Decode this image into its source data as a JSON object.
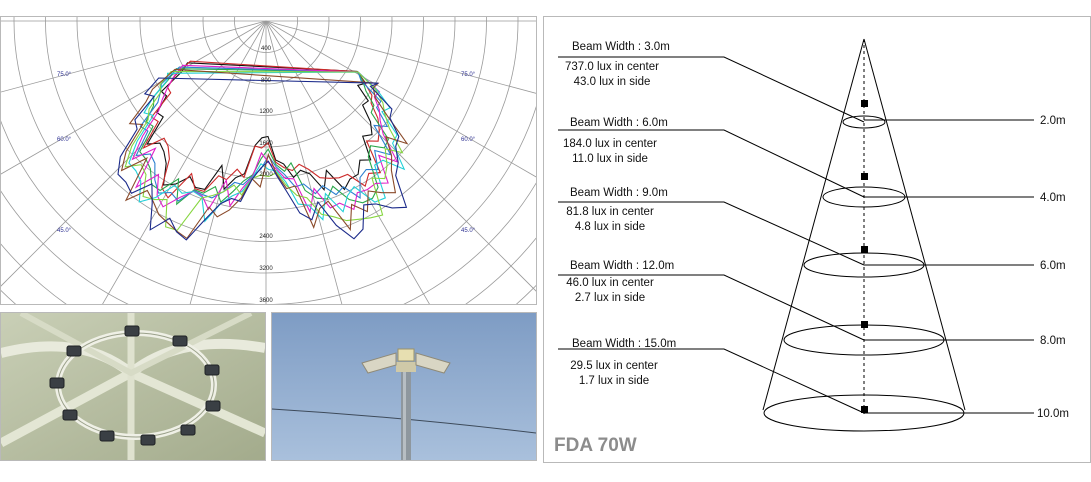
{
  "polar": {
    "angle_labels": [
      "75.0°",
      "75.0°",
      "60.0°",
      "60.0°",
      "45.0°",
      "45.0°"
    ],
    "radial_labels": [
      "400",
      "800",
      "1200",
      "1600",
      "2000",
      "2400",
      "2800",
      "3200",
      "3600"
    ],
    "curve_colors": [
      "#111111",
      "#cc2a2a",
      "#2aa84a",
      "#2c7fd0",
      "#e020c8",
      "#22d0d8",
      "#86d640",
      "#8a4a2a",
      "#1b2a8a"
    ]
  },
  "photos": {
    "fixture_alt": "ring fixture",
    "pole_alt": "pole lights"
  },
  "cone": {
    "title": "FDA 70W",
    "levels": [
      {
        "beam": "Beam Width : 3.0m",
        "center": "737.0 lux in center",
        "side": "43.0 lux in side",
        "height": "2.0m"
      },
      {
        "beam": "Beam Width : 6.0m",
        "center": "184.0 lux in center",
        "side": "11.0 lux in side",
        "height": "4.0m"
      },
      {
        "beam": "Beam Width : 9.0m",
        "center": "81.8 lux in center",
        "side": "4.8 lux in side",
        "height": "6.0m"
      },
      {
        "beam": "Beam Width : 12.0m",
        "center": "46.0 lux in center",
        "side": "2.7 lux in side",
        "height": "8.0m"
      },
      {
        "beam": "Beam Width : 15.0m",
        "center": "29.5 lux in center",
        "side": "1.7 lux in side",
        "height": "10.0m"
      }
    ]
  }
}
